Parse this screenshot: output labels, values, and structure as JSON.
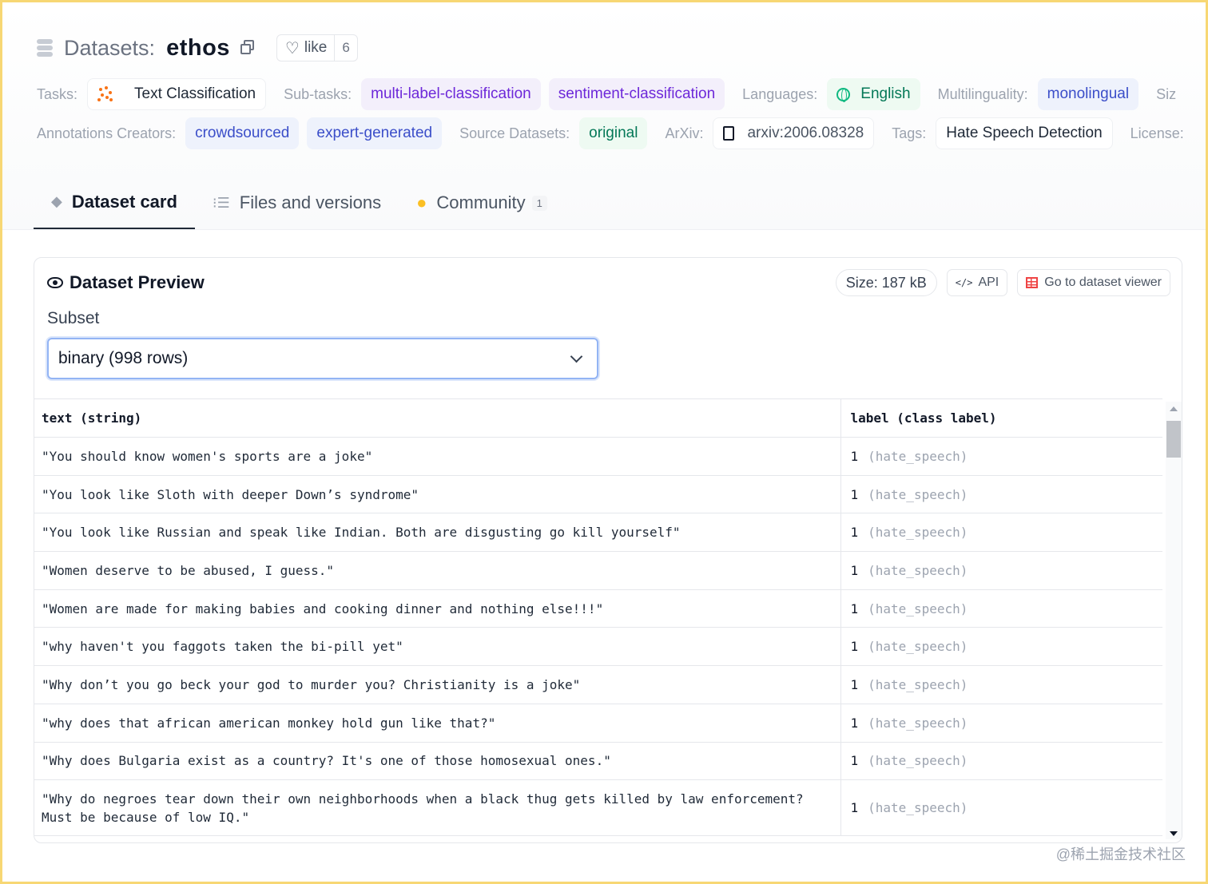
{
  "header": {
    "title_prefix": "Datasets:",
    "title_name": "ethos",
    "like_label": "like",
    "like_count": "6"
  },
  "tags_row1": {
    "tasks_label": "Tasks:",
    "tasks_value": "Text Classification",
    "subtasks_label": "Sub-tasks:",
    "subtasks": [
      "multi-label-classification",
      "sentiment-classification"
    ],
    "languages_label": "Languages:",
    "languages_value": "English",
    "multilinguality_label": "Multilinguality:",
    "multilinguality_value": "monolingual",
    "size_label_cut": "Siz"
  },
  "tags_row2": {
    "annotations_label": "Annotations Creators:",
    "annotations": [
      "crowdsourced",
      "expert-generated"
    ],
    "source_label": "Source Datasets:",
    "source_value": "original",
    "arxiv_label": "ArXiv:",
    "arxiv_value": "arxiv:2006.08328",
    "tags_label": "Tags:",
    "tags_value": "Hate Speech Detection",
    "license_label": "License:"
  },
  "tabs": [
    {
      "label": "Dataset card",
      "active": true
    },
    {
      "label": "Files and versions",
      "active": false
    },
    {
      "label": "Community",
      "active": false,
      "badge": "1"
    }
  ],
  "preview": {
    "title": "Dataset Preview",
    "size_label": "Size: 187 kB",
    "api_label": "API",
    "viewer_label": "Go to dataset viewer",
    "subset_label": "Subset",
    "subset_value": "binary (998 rows)"
  },
  "table": {
    "columns": [
      "text (string)",
      "label (class label)"
    ],
    "rows": [
      {
        "text": "\"You should know women's sports are a joke\"",
        "label": "1",
        "label_name": "(hate_speech)"
      },
      {
        "text": "\"You look like Sloth with deeper Down’s syndrome\"",
        "label": "1",
        "label_name": "(hate_speech)"
      },
      {
        "text": "\"You look like Russian and speak like Indian. Both are disgusting go kill yourself\"",
        "label": "1",
        "label_name": "(hate_speech)"
      },
      {
        "text": "\"Women deserve to be abused, I guess.\"",
        "label": "1",
        "label_name": "(hate_speech)"
      },
      {
        "text": "\"Women are made for making babies and cooking dinner and nothing else!!!\"",
        "label": "1",
        "label_name": "(hate_speech)"
      },
      {
        "text": "\"why haven't you faggots taken the bi-pill yet\"",
        "label": "1",
        "label_name": "(hate_speech)"
      },
      {
        "text": "\"Why don’t you go beck your god to murder you? Christianity is a joke\"",
        "label": "1",
        "label_name": "(hate_speech)"
      },
      {
        "text": "\"why does that african american monkey hold gun like that?\"",
        "label": "1",
        "label_name": "(hate_speech)"
      },
      {
        "text": "\"Why does Bulgaria exist as a country? It's one of those homosexual ones.\"",
        "label": "1",
        "label_name": "(hate_speech)"
      },
      {
        "text": "\"Why do negroes tear down their own neighborhoods when a black thug gets killed by law enforcement? Must be because of low IQ.\"",
        "label": "1",
        "label_name": "(hate_speech)"
      }
    ]
  },
  "watermark": "@稀土掘金技术社区",
  "colors": {
    "frame": "#f7d774",
    "purple_tag": "#6d28d9",
    "blue_tag": "#3b4ec9",
    "green_tag": "#047857",
    "select_focus": "#93b4f4"
  }
}
